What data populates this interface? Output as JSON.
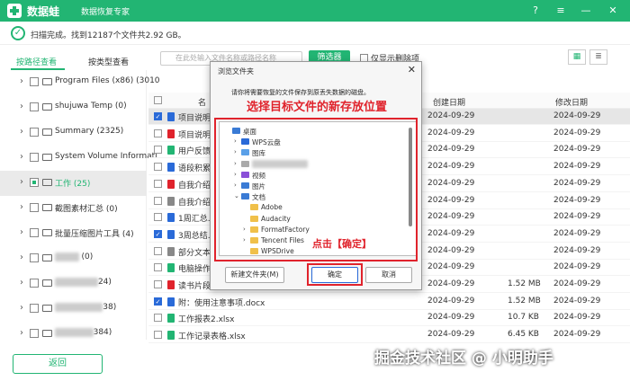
{
  "header": {
    "app_name": "数据蛙",
    "subtitle": "数据恢复专家",
    "help": "?",
    "menu": "≡",
    "minimize": "—",
    "close": "✕"
  },
  "status": {
    "check": "✓",
    "text": "扫描完成。找到12187个文件共2.92 GB。"
  },
  "tabs": {
    "by_path": "按路径查看",
    "by_type": "按类型查看"
  },
  "search": {
    "placeholder": "在此处输入文件名称或路径名称"
  },
  "filter": {
    "label": "筛选器"
  },
  "only_deleted": {
    "label": "仅显示删除项"
  },
  "view": {
    "grid": "▦",
    "list": "≣"
  },
  "sidebar": {
    "items": [
      {
        "label": "Program Files (x86) (3010",
        "blurred": false
      },
      {
        "label": "shujuwa Temp (0)",
        "blurred": false
      },
      {
        "label": "Summary (2325)",
        "blurred": false
      },
      {
        "label": "System Volume Informati",
        "blurred": false
      },
      {
        "label": "工作 (25)",
        "blurred": false
      },
      {
        "label": "截图素材汇总 (0)",
        "blurred": false
      },
      {
        "label": "批量压缩图片工具 (4)",
        "blurred": false
      },
      {
        "label": "(0)",
        "blurred": true
      },
      {
        "label": "24)",
        "blurred": true
      },
      {
        "label": "38)",
        "blurred": true
      },
      {
        "label": "384)",
        "blurred": true
      }
    ]
  },
  "table": {
    "col_name": "名",
    "col_create": "创建日期",
    "col_mod": "修改日期",
    "rows": [
      {
        "name": "项目说明书",
        "size": "",
        "date_c": "2024-09-29",
        "date_m": "2024-09-29",
        "checked": true,
        "color": "#2a6ad8"
      },
      {
        "name": "项目说明书",
        "size": "",
        "date_c": "2024-09-29",
        "date_m": "2024-09-29",
        "checked": false,
        "color": "#e0232c"
      },
      {
        "name": "用户反馈数",
        "size": "",
        "date_c": "2024-09-29",
        "date_m": "2024-09-29",
        "checked": false,
        "color": "#22b573"
      },
      {
        "name": "语段积累.d",
        "size": "",
        "date_c": "2024-09-29",
        "date_m": "2024-09-29",
        "checked": false,
        "color": "#2a6ad8"
      },
      {
        "name": "自我介绍.p",
        "size": "",
        "date_c": "2024-09-29",
        "date_m": "2024-09-29",
        "checked": false,
        "color": "#e0232c"
      },
      {
        "name": "自我介绍.t",
        "size": "",
        "date_c": "2024-09-29",
        "date_m": "2024-09-29",
        "checked": false,
        "color": "#888"
      },
      {
        "name": "1周汇总.do",
        "size": "",
        "date_c": "2024-09-29",
        "date_m": "2024-09-29",
        "checked": false,
        "color": "#2a6ad8"
      },
      {
        "name": "3周总结.d",
        "size": "",
        "date_c": "2024-09-29",
        "date_m": "2024-09-29",
        "checked": true,
        "color": "#2a6ad8"
      },
      {
        "name": "部分文本模",
        "size": "",
        "date_c": "2024-09-29",
        "date_m": "2024-09-29",
        "checked": false,
        "color": "#888"
      },
      {
        "name": "电脑操作技",
        "size": "",
        "date_c": "2024-09-29",
        "date_m": "2024-09-29",
        "checked": false,
        "color": "#22b573"
      },
      {
        "name": "读书片段记录.pptx",
        "size": "1.52 MB",
        "date_c": "2024-09-29",
        "date_m": "2024-09-29",
        "checked": false,
        "color": "#e0232c"
      },
      {
        "name": "附：使用注意事项.docx",
        "size": "1.52 MB",
        "date_c": "2024-09-29",
        "date_m": "2024-09-29",
        "checked": true,
        "color": "#2a6ad8"
      },
      {
        "name": "工作报表2.xlsx",
        "size": "10.7 KB",
        "date_c": "2024-09-29",
        "date_m": "2024-09-29",
        "checked": false,
        "color": "#22b573"
      },
      {
        "name": "工作记录表格.xlsx",
        "size": "6.45 KB",
        "date_c": "2024-09-29",
        "date_m": "2024-09-29",
        "checked": false,
        "color": "#22b573"
      }
    ]
  },
  "back": {
    "label": "返回"
  },
  "watermark": "掘金技术社区 @ 小明助手",
  "dialog": {
    "title": "浏览文件夹",
    "close": "✕",
    "message": "请你将需要恢复的文件保存到原丢失数据的磁盘。",
    "annotation": "选择目标文件的新存放位置",
    "tree": [
      {
        "label": "桌面",
        "depth": 0,
        "arrow": "",
        "color": "#3a7bd5"
      },
      {
        "label": "WPS云盘",
        "depth": 1,
        "arrow": "›",
        "color": "#2a6ad8"
      },
      {
        "label": "图库",
        "depth": 1,
        "arrow": "›",
        "color": "#5aa0e8"
      },
      {
        "label": "",
        "depth": 1,
        "arrow": "›",
        "color": "#aaa",
        "blurred": true
      },
      {
        "label": "视频",
        "depth": 1,
        "arrow": "›",
        "color": "#8a4fd8"
      },
      {
        "label": "图片",
        "depth": 1,
        "arrow": "›",
        "color": "#3a7bd5"
      },
      {
        "label": "文档",
        "depth": 1,
        "arrow": "⌄",
        "color": "#3a7bd5"
      },
      {
        "label": "Adobe",
        "depth": 2,
        "arrow": "",
        "color": "#f0c04a"
      },
      {
        "label": "Audacity",
        "depth": 2,
        "arrow": "",
        "color": "#f0c04a"
      },
      {
        "label": "FormatFactory",
        "depth": 2,
        "arrow": "›",
        "color": "#f0c04a"
      },
      {
        "label": "Tencent Files",
        "depth": 2,
        "arrow": "›",
        "color": "#f0c04a"
      },
      {
        "label": "WPSDrive",
        "depth": 2,
        "arrow": "",
        "color": "#f0c04a"
      }
    ],
    "annotation2": "点击【确定】",
    "new_folder": "新建文件夹(M)",
    "ok": "确定",
    "cancel": "取消"
  }
}
